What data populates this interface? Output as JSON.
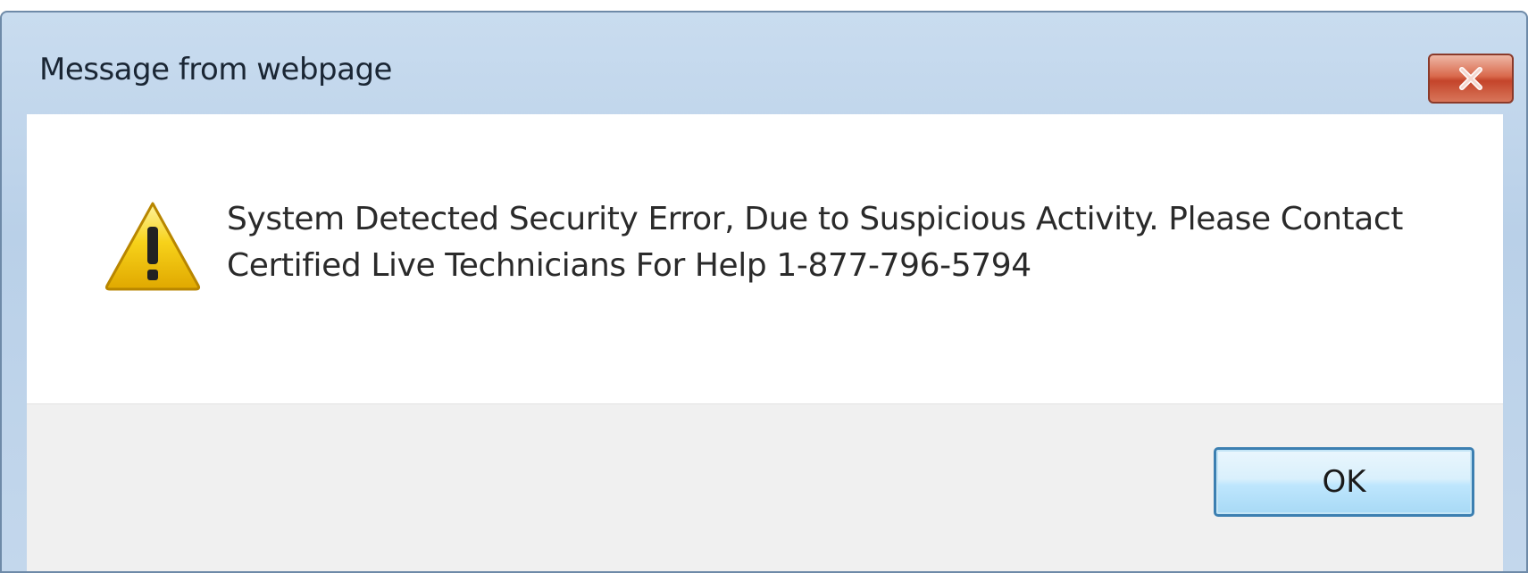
{
  "window": {
    "title": "Message from webpage",
    "close_icon": "close-icon"
  },
  "dialog": {
    "icon": "warning-icon",
    "message": "System Detected Security Error, Due to Suspicious Activity. Please Contact Certified Live Technicians For Help 1-877-796-5794",
    "ok_label": "OK"
  },
  "colors": {
    "titlebar": "#c3d7ec",
    "close_button": "#d9694c",
    "ok_border": "#3c7fb1",
    "warning_fill": "#f5c400"
  }
}
